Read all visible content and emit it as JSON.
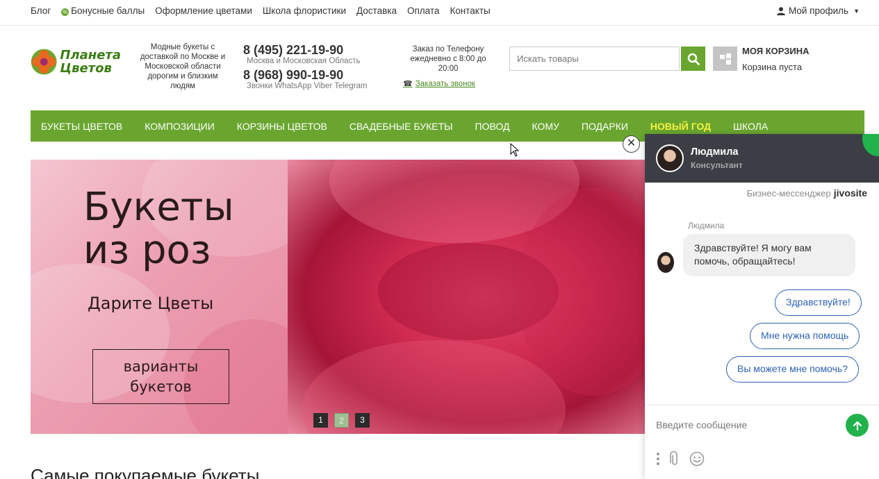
{
  "topbar": {
    "links": [
      "Блог",
      "Бонусные баллы",
      "Оформление цветами",
      "Школа флористики",
      "Доставка",
      "Оплата",
      "Контакты"
    ],
    "profile": "Мой профиль"
  },
  "header": {
    "logo_line1": "Планета",
    "logo_line2": "Цветов",
    "tagline": "Модные букеты с доставкой по Москве и Московской области дорогим и близким людям",
    "phone1": "8 (495) 221-19-90",
    "phone1_sub": "Москва и Московская Область",
    "phone2": "8 (968) 990-19-90",
    "phone2_sub": "Звонки WhatsApp Viber Telegram",
    "order_info": "Заказ по Телефону ежедневно с 8:00 до 20:00",
    "callback": "Заказать звонок",
    "search_placeholder": "Искать товары",
    "cart_title": "МОЯ КОРЗИНА",
    "cart_sub": "Корзина пуста"
  },
  "nav": {
    "items": [
      "БУКЕТЫ ЦВЕТОВ",
      "КОМПОЗИЦИИ",
      "КОРЗИНЫ ЦВЕТОВ",
      "СВАДЕБНЫЕ БУКЕТЫ",
      "ПОВОД",
      "КОМУ",
      "ПОДАРКИ",
      "НОВЫЙ ГОД",
      "ШКОЛА"
    ]
  },
  "banner": {
    "title_line1": "Букеты",
    "title_line2": "из роз",
    "subtitle": "Дарите Цветы",
    "button_line1": "варианты",
    "button_line2": "букетов",
    "pages": [
      "1",
      "2",
      "3"
    ],
    "active_page": "2"
  },
  "section_title": "Самые покупаемые букеты",
  "chat": {
    "agent_name": "Людмила",
    "agent_role": "Консультант",
    "brand_label": "Бизнес-мессенджер",
    "brand_name": "jivosite",
    "message_author": "Людмила",
    "message_text": "Здравствуйте! Я могу вам помочь, обращайтесь!",
    "quick_replies": [
      "Здравствуйте!",
      "Мне нужна помощь",
      "Вы можете мне помочь?"
    ],
    "input_placeholder": "Введите сообщение"
  },
  "colors": {
    "brand_green": "#6aa62f",
    "highlight": "#f4f240",
    "chat_header": "#3b3f45",
    "chat_accent": "#22b24c",
    "reply_blue": "#2c62b5"
  }
}
